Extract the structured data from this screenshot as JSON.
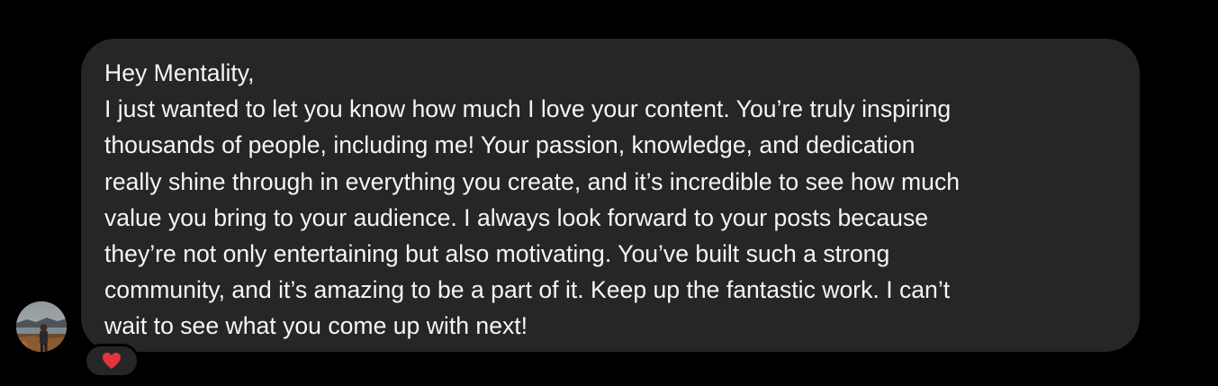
{
  "message": {
    "lines": [
      "Hey Mentality,",
      "I just wanted to let you know how much I love your content. You’re truly inspiring",
      "thousands of people, including me! Your passion, knowledge, and dedication",
      "really shine through in everything you create, and it’s incredible to see how much",
      "value you bring to your audience. I always look forward to your posts because",
      "they’re not only entertaining but also motivating. You’ve built such a strong",
      "community, and it’s amazing to be a part of it. Keep up the fantastic work. I can’t",
      "wait to see what you come up with next!"
    ]
  },
  "sender": {
    "avatar_icon": "profile-photo"
  },
  "reaction": {
    "icon": "red-heart-icon",
    "color": "#e0343f"
  },
  "colors": {
    "background": "#000000",
    "bubble": "#262626",
    "text": "#f5f5f5"
  }
}
